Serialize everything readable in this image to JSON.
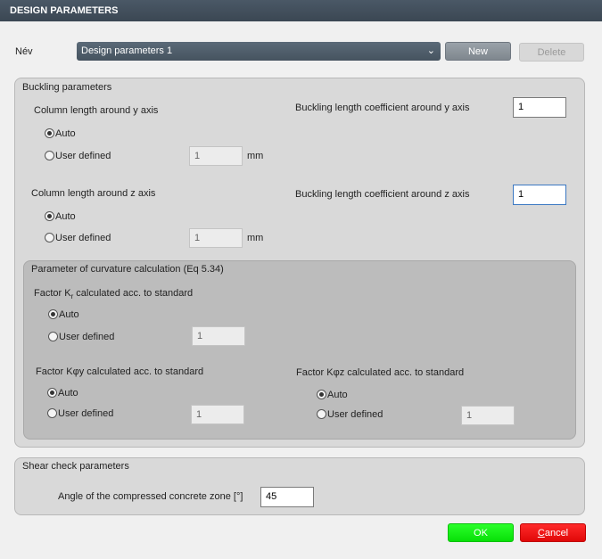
{
  "window": {
    "title": "DESIGN PARAMETERS"
  },
  "name_row": {
    "label": "Név",
    "selected": "Design parameters 1",
    "new_label": "New",
    "delete_label": "Delete"
  },
  "buckling": {
    "title": "Buckling parameters",
    "y": {
      "column_label": "Column length around y axis",
      "auto_label": "Auto",
      "user_label": "User defined",
      "user_value": "1",
      "unit": "mm",
      "coef_label": "Buckling length coefficient around y axis",
      "coef_value": "1"
    },
    "z": {
      "column_label": "Column length around z axis",
      "auto_label": "Auto",
      "user_label": "User defined",
      "user_value": "1",
      "unit": "mm",
      "coef_label": "Buckling length coefficient around z axis",
      "coef_value": "1"
    }
  },
  "curvature": {
    "title": "Parameter of curvature calculation (Eq 5.34)",
    "kr": {
      "label_pre": "Factor K",
      "label_sub": "r",
      "label_post": " calculated acc. to standard",
      "auto_label": "Auto",
      "user_label": "User defined",
      "user_value": "1"
    },
    "kphiy": {
      "label": "Factor Kφy calculated acc. to standard",
      "auto_label": "Auto",
      "user_label": "User defined",
      "user_value": "1"
    },
    "kphiz": {
      "label": "Factor Kφz calculated acc. to standard",
      "auto_label": "Auto",
      "user_label": "User defined",
      "user_value": "1"
    }
  },
  "shear": {
    "title": "Shear check parameters",
    "angle_label": "Angle of the compressed concrete zone [°]",
    "angle_value": "45"
  },
  "footer": {
    "ok_label": "OK",
    "cancel_first": "C",
    "cancel_rest": "ancel"
  },
  "colors": {
    "title_bar": "#3f4b57",
    "ok_button": "#14f014",
    "cancel_button": "#f01010"
  }
}
